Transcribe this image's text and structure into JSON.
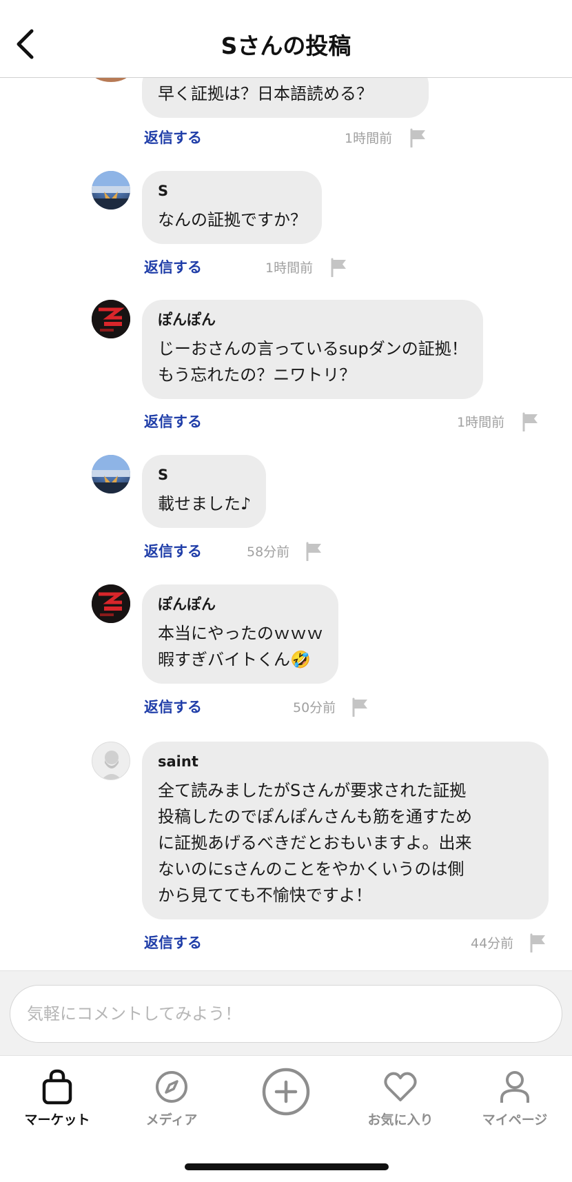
{
  "header": {
    "title": "Sさんの投稿"
  },
  "comments": [
    {
      "username": "",
      "text": "早く証拠は？日本語読める？",
      "reply_label": "返信する",
      "time": "1時間前"
    },
    {
      "username": "S",
      "text": "なんの証拠ですか？",
      "reply_label": "返信する",
      "time": "1時間前"
    },
    {
      "username": "ぽんぽん",
      "text": "じーおさんの言っているsupダンの証拠！\nもう忘れたの？ニワトリ？",
      "reply_label": "返信する",
      "time": "1時間前"
    },
    {
      "username": "S",
      "text": "載せました♪",
      "reply_label": "返信する",
      "time": "58分前"
    },
    {
      "username": "ぽんぽん",
      "text": "本当にやったのｗｗｗ\n暇すぎバイトくん🤣",
      "reply_label": "返信する",
      "time": "50分前"
    },
    {
      "username": "saint",
      "text": "全て読みましたがSさんが要求された証拠\n投稿したのでぽんぽんさんも筋を通すため\nに証拠あげるべきだとおもいますよ。出来\nないのにsさんのことをやかくいうのは側\nから見てても不愉快ですよ！",
      "reply_label": "返信する",
      "time": "44分前"
    }
  ],
  "comment_input": {
    "placeholder": "気軽にコメントしてみよう！"
  },
  "nav": [
    {
      "label": "マーケット",
      "icon": "bag-icon",
      "active": true
    },
    {
      "label": "メディア",
      "icon": "compass-icon",
      "active": false
    },
    {
      "label": "",
      "icon": "plus-circle-icon",
      "active": false
    },
    {
      "label": "お気に入り",
      "icon": "heart-icon",
      "active": false
    },
    {
      "label": "マイページ",
      "icon": "person-icon",
      "active": false
    }
  ],
  "colors": {
    "reply_link": "#1f3da8",
    "bubble": "#ececec",
    "muted_text": "#a0a0a0"
  }
}
